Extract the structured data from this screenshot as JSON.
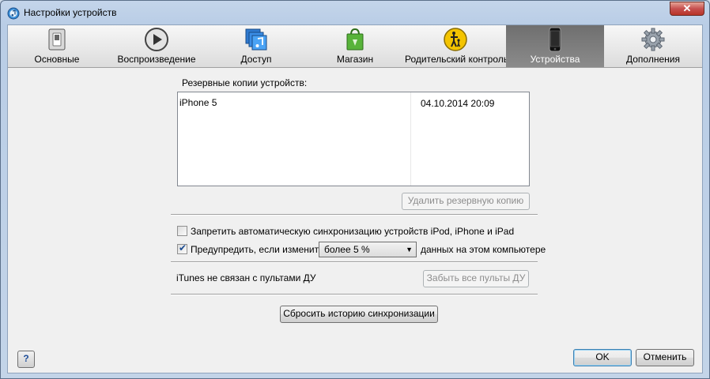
{
  "window": {
    "title": "Настройки устройств",
    "close_label": "✕"
  },
  "tabs": [
    {
      "label": "Основные",
      "icon": "switch-icon"
    },
    {
      "label": "Воспроизведение",
      "icon": "play-icon"
    },
    {
      "label": "Доступ",
      "icon": "music-note-icon"
    },
    {
      "label": "Магазин",
      "icon": "shopping-bag-icon"
    },
    {
      "label": "Родительский контроль",
      "icon": "parental-icon"
    },
    {
      "label": "Устройства",
      "icon": "iphone-icon",
      "selected": true
    },
    {
      "label": "Дополнения",
      "icon": "gear-icon"
    }
  ],
  "backups": {
    "label": "Резервные копии устройств:",
    "items": [
      {
        "name": "iPhone 5",
        "date": "04.10.2014 20:09"
      }
    ],
    "delete_label": "Удалить резервную копию"
  },
  "options": {
    "prevent_sync_label": "Запретить автоматическую синхронизацию устройств iPod, iPhone и iPad",
    "prevent_sync_checked": false,
    "warn_label": "Предупредить, если изменится",
    "warn_checked": true,
    "warn_select_value": "более 5 %",
    "warn_suffix": "данных на этом компьютере"
  },
  "remotes": {
    "status": "iTunes не связан с пультами ДУ",
    "forget_label": "Забыть все пульты ДУ"
  },
  "reset_history_label": "Сбросить историю синхронизации",
  "footer": {
    "help_label": "?",
    "ok_label": "OK",
    "cancel_label": "Отменить"
  }
}
